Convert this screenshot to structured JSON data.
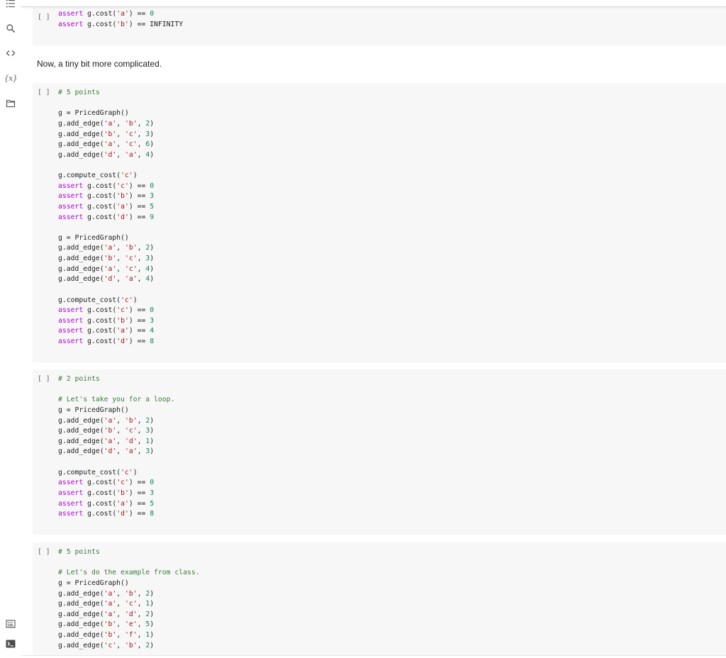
{
  "sidebar": {
    "top_icons": [
      "table-of-contents-icon",
      "search-icon",
      "code-snippets-icon",
      "variables-icon",
      "files-icon"
    ],
    "variables_glyph": "{x}",
    "bottom_icons": [
      "command-palette-icon",
      "terminal-icon"
    ]
  },
  "syntax_colors": {
    "keyword": "#af00db",
    "string": "#a31515",
    "number": "#098658",
    "comment": "#3d7a3d",
    "plain": "#212121"
  },
  "cells": [
    {
      "type": "code",
      "prompt": "[ ]",
      "lines": [
        "assert g.cost('a') == 0",
        "assert g.cost('b') == INFINITY"
      ]
    },
    {
      "type": "text",
      "text": "Now, a tiny bit more complicated."
    },
    {
      "type": "code",
      "prompt": "[ ]",
      "lines": [
        "# 5 points",
        "",
        "g = PricedGraph()",
        "g.add_edge('a', 'b', 2)",
        "g.add_edge('b', 'c', 3)",
        "g.add_edge('a', 'c', 6)",
        "g.add_edge('d', 'a', 4)",
        "",
        "g.compute_cost('c')",
        "assert g.cost('c') == 0",
        "assert g.cost('b') == 3",
        "assert g.cost('a') == 5",
        "assert g.cost('d') == 9",
        "",
        "g = PricedGraph()",
        "g.add_edge('a', 'b', 2)",
        "g.add_edge('b', 'c', 3)",
        "g.add_edge('a', 'c', 4)",
        "g.add_edge('d', 'a', 4)",
        "",
        "g.compute_cost('c')",
        "assert g.cost('c') == 0",
        "assert g.cost('b') == 3",
        "assert g.cost('a') == 4",
        "assert g.cost('d') == 8"
      ]
    },
    {
      "type": "code",
      "prompt": "[ ]",
      "lines": [
        "# 2 points",
        "",
        "# Let's take you for a loop.",
        "g = PricedGraph()",
        "g.add_edge('a', 'b', 2)",
        "g.add_edge('b', 'c', 3)",
        "g.add_edge('a', 'd', 1)",
        "g.add_edge('d', 'a', 3)",
        "",
        "g.compute_cost('c')",
        "assert g.cost('c') == 0",
        "assert g.cost('b') == 3",
        "assert g.cost('a') == 5",
        "assert g.cost('d') == 8"
      ]
    },
    {
      "type": "code",
      "prompt": "[ ]",
      "lines": [
        "# 5 points",
        "",
        "# Let's do the example from class.",
        "g = PricedGraph()",
        "g.add_edge('a', 'b', 2)",
        "g.add_edge('a', 'c', 1)",
        "g.add_edge('a', 'd', 2)",
        "g.add_edge('b', 'e', 5)",
        "g.add_edge('b', 'f', 1)",
        "g.add_edge('c', 'b', 2)"
      ]
    }
  ]
}
